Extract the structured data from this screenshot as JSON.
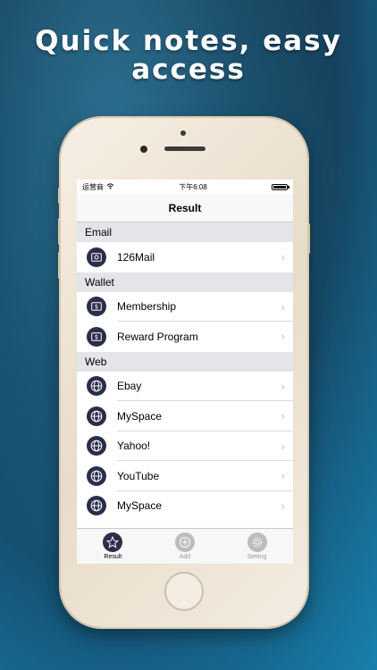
{
  "headline": {
    "line1": "Quick notes, easy",
    "line2": "access"
  },
  "status_bar": {
    "carrier": "运营商",
    "time": "下午6:08"
  },
  "navbar": {
    "title": "Result"
  },
  "sections": [
    {
      "header": "Email",
      "items": [
        {
          "label": "126Mail",
          "icon": "email-icon"
        }
      ]
    },
    {
      "header": "Wallet",
      "items": [
        {
          "label": "Membership",
          "icon": "wallet-icon"
        },
        {
          "label": "Reward Program",
          "icon": "wallet-icon"
        }
      ]
    },
    {
      "header": "Web",
      "items": [
        {
          "label": "Ebay",
          "icon": "globe-icon"
        },
        {
          "label": "MySpace",
          "icon": "globe-icon"
        },
        {
          "label": "Yahoo!",
          "icon": "globe-icon"
        },
        {
          "label": "YouTube",
          "icon": "globe-icon"
        },
        {
          "label": "MySpace",
          "icon": "globe-icon"
        }
      ]
    }
  ],
  "tabbar": {
    "tabs": [
      {
        "label": "Result",
        "icon": "star-icon",
        "active": true
      },
      {
        "label": "Add",
        "icon": "add-icon",
        "active": false
      },
      {
        "label": "Setting",
        "icon": "gear-icon",
        "active": false
      }
    ]
  },
  "colors": {
    "icon_bg": "#2a2e4a",
    "section_bg": "#e5e4ea",
    "chevron": "#c7c7cc"
  }
}
